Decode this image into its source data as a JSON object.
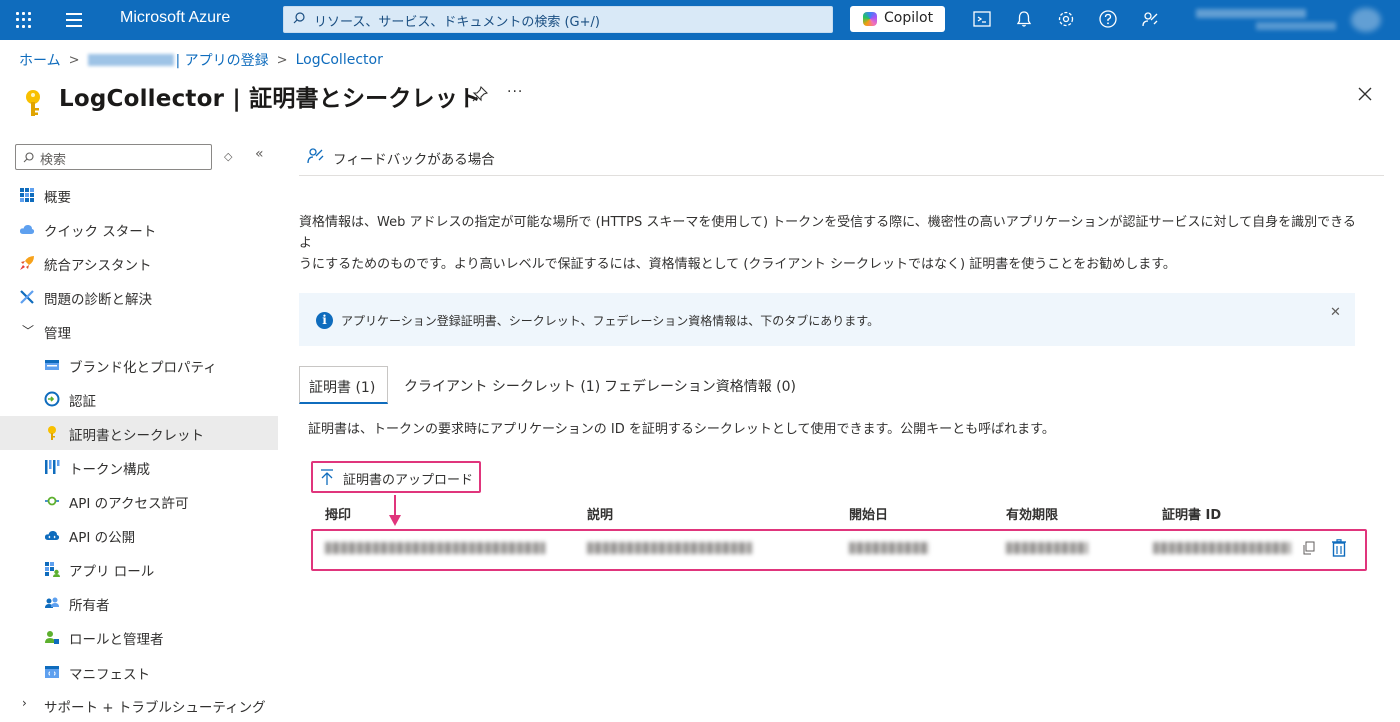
{
  "topbar": {
    "brand": "Microsoft Azure",
    "search_placeholder": "リソース、サービス、ドキュメントの検索 (G+/)",
    "copilot_label": "Copilot",
    "icons": [
      "waffle-icon",
      "menu-icon",
      "cloud-shell-icon",
      "bell-icon",
      "settings-icon",
      "help-icon",
      "feedback-icon"
    ],
    "accent": "#0f6cbd"
  },
  "breadcrumb": {
    "home": "ホーム",
    "app_registrations": "| アプリの登録",
    "current": "LogCollector"
  },
  "header": {
    "title": "LogCollector | 証明書とシークレット",
    "more": "···"
  },
  "sidebar": {
    "search_placeholder": "検索",
    "items": [
      {
        "label": "概要",
        "icon": "overview-grid-icon"
      },
      {
        "label": "クイック スタート",
        "icon": "cloud-icon"
      },
      {
        "label": "統合アシスタント",
        "icon": "rocket-icon"
      },
      {
        "label": "問題の診断と解決",
        "icon": "wrench-icon"
      },
      {
        "label": "管理",
        "icon": "chevron-down-icon"
      },
      {
        "label": "ブランド化とプロパティ",
        "icon": "branding-icon"
      },
      {
        "label": "認証",
        "icon": "auth-icon"
      },
      {
        "label": "証明書とシークレット",
        "icon": "key-icon"
      },
      {
        "label": "トークン構成",
        "icon": "token-bars-icon"
      },
      {
        "label": "API のアクセス許可",
        "icon": "api-permission-icon"
      },
      {
        "label": "API の公開",
        "icon": "cloud-api-icon"
      },
      {
        "label": "アプリ ロール",
        "icon": "app-roles-icon"
      },
      {
        "label": "所有者",
        "icon": "owners-icon"
      },
      {
        "label": "ロールと管理者",
        "icon": "roles-admins-icon"
      },
      {
        "label": "マニフェスト",
        "icon": "manifest-icon"
      },
      {
        "label": "サポート + トラブルシューティング",
        "icon": "chevron-right-icon"
      }
    ]
  },
  "main": {
    "feedback_label": "フィードバックがある場合",
    "description_line1": "資格情報は、Web アドレスの指定が可能な場所で (HTTPS スキーマを使用して) トークンを受信する際に、機密性の高いアプリケーションが認証サービスに対して自身を識別できるよ",
    "description_line2": "うにするためのものです。より高いレベルで保証するには、資格情報として (クライアント シークレットではなく) 証明書を使うことをお勧めします。",
    "info_text": "アプリケーション登録証明書、シークレット、フェデレーション資格情報は、下のタブにあります。",
    "tabs": [
      {
        "label": "証明書 (1)",
        "active": true
      },
      {
        "label": "クライアント シークレット (1)",
        "active": false
      },
      {
        "label": "フェデレーション資格情報 (0)",
        "active": false
      }
    ],
    "tab_description": "証明書は、トークンの要求時にアプリケーションの ID を証明するシークレットとして使用できます。公開キーとも呼ばれます。",
    "upload_label": "証明書のアップロード",
    "table": {
      "columns": [
        "拇印",
        "説明",
        "開始日",
        "有効期限",
        "証明書 ID"
      ]
    },
    "highlight_color": "#e0357c"
  }
}
